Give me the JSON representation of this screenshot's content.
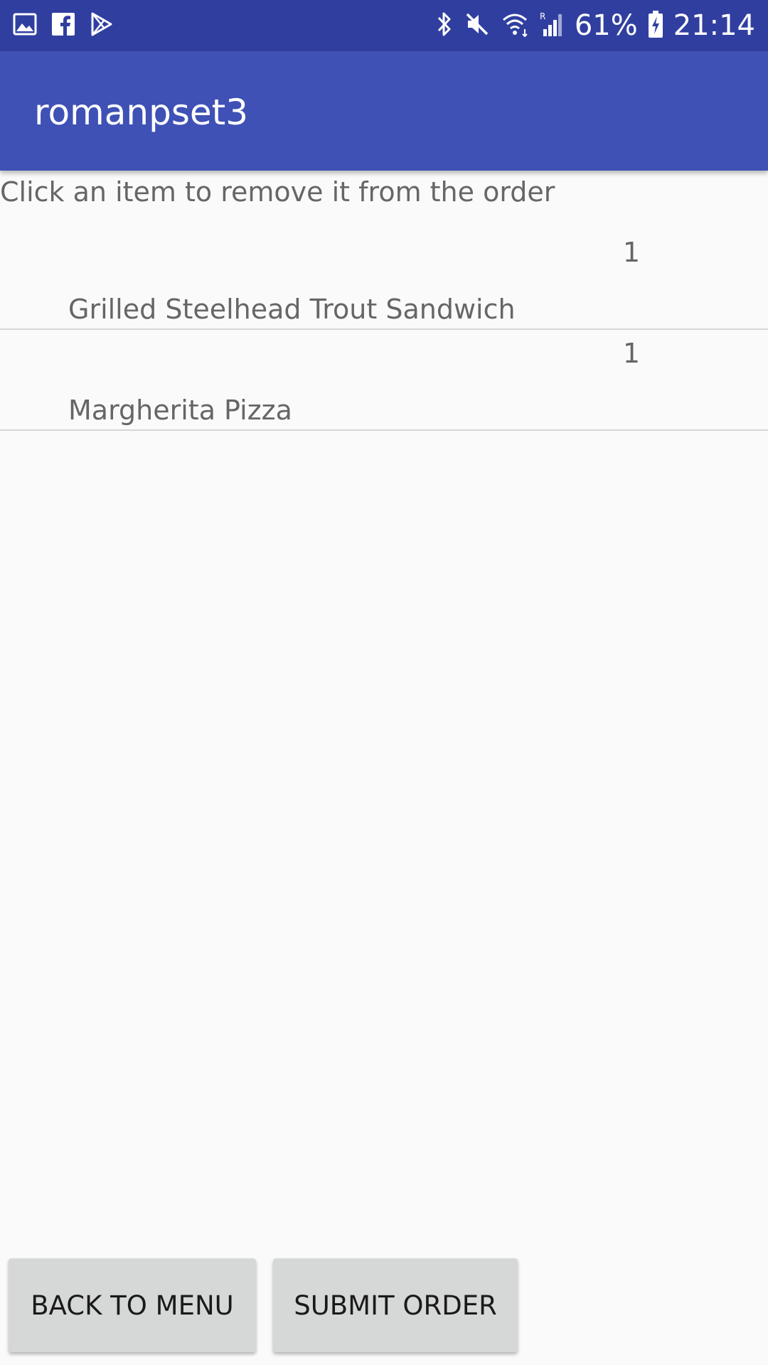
{
  "status_bar": {
    "left_icons": [
      "gallery-icon",
      "facebook-icon",
      "play-store-icon"
    ],
    "right_icons": [
      "bluetooth-icon",
      "mute-icon",
      "wifi-icon",
      "signal-icon"
    ],
    "battery_percent": "61%",
    "time": "21:14"
  },
  "app_bar": {
    "title": "romanpset3"
  },
  "instruction": "Click an item to remove it from the order",
  "order_items": [
    {
      "quantity": "1",
      "name": "Grilled Steelhead Trout Sandwich"
    },
    {
      "quantity": "1",
      "name": "Margherita Pizza"
    }
  ],
  "buttons": {
    "back": "BACK TO MENU",
    "submit": "SUBMIT ORDER"
  },
  "colors": {
    "status_bar": "#303f9f",
    "app_bar": "#3f51b5",
    "background": "#fafafa",
    "button": "#d6d7d7"
  }
}
